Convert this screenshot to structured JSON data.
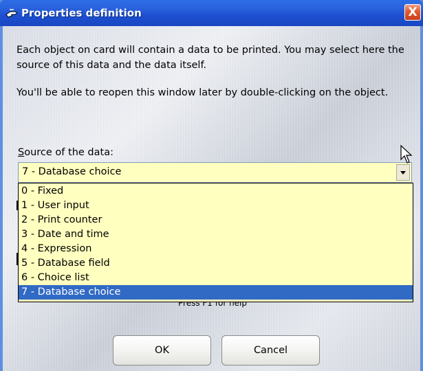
{
  "window": {
    "title": "Properties definition",
    "close_label": "X"
  },
  "description": {
    "line1": "Each object on card will contain a data to be printed. You may select here the source of this data and the data itself.",
    "line2": "You'll be able to reopen this window later by double-clicking on the object."
  },
  "source": {
    "label_accesskey": "S",
    "label_rest": "ource of the data:",
    "selected_value": "7 - Database choice",
    "options": [
      "0 - Fixed",
      "1 - User input",
      "2 - Print counter",
      "3 - Date and time",
      "4 - Expression",
      "5 - Database field",
      "6 - Choice list",
      "7 - Database choice"
    ],
    "selected_index": 7
  },
  "help": {
    "text": "Press F1 for help"
  },
  "buttons": {
    "ok_label": "OK",
    "cancel_label": "Cancel"
  },
  "icons": {
    "title": "properties-hand-icon",
    "close": "close-icon",
    "dropdown": "chevron-down-icon",
    "cursor": "mouse-pointer-icon"
  },
  "colors": {
    "titlebar": "#2a63dd",
    "combo_background": "#ffffc0",
    "selection": "#316ac5",
    "close_button": "#e05a30"
  }
}
